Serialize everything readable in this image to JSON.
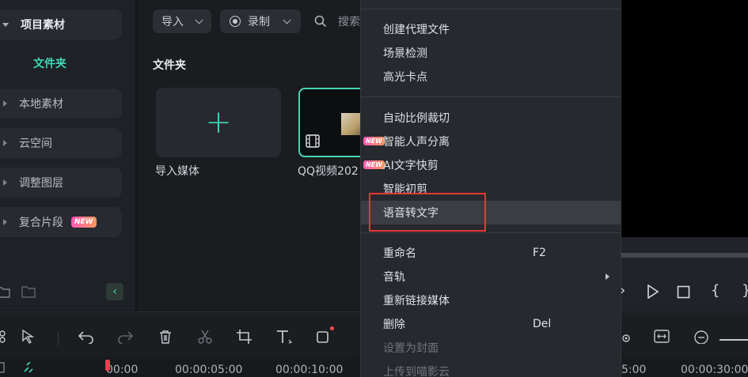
{
  "sidebar": {
    "items": [
      {
        "label": "项目素材"
      },
      {
        "label": "本地素材"
      },
      {
        "label": "云空间"
      },
      {
        "label": "调整图层"
      },
      {
        "label": "复合片段"
      }
    ],
    "folder": "文件夹",
    "new_badge": "NEW"
  },
  "media": {
    "import_label": "导入",
    "record_label": "录制",
    "search_placeholder": "搜索",
    "section_title": "文件夹",
    "cards": [
      {
        "label": "导入媒体"
      },
      {
        "label": "QQ视频202"
      }
    ]
  },
  "context_menu": {
    "items": [
      {
        "label": "创建代理文件"
      },
      {
        "label": "场景检测"
      },
      {
        "label": "高光卡点"
      },
      {
        "label": "自动比例裁切"
      },
      {
        "label": "智能人声分离",
        "badge": "NEW"
      },
      {
        "label": "AI文字快剪",
        "badge": "NEW"
      },
      {
        "label": "智能初剪"
      },
      {
        "label": "语音转文字"
      },
      {
        "label": "重命名",
        "shortcut": "F2"
      },
      {
        "label": "音轨"
      },
      {
        "label": "重新链接媒体"
      },
      {
        "label": "删除",
        "shortcut": "Del"
      },
      {
        "label": "设置为封面"
      },
      {
        "label": "上传到喵影云"
      }
    ]
  },
  "timeline": {
    "ticks": [
      "00:00",
      "00:00:05:00",
      "00:00:10:00",
      "5:00",
      "00:00:30:00"
    ]
  },
  "colors": {
    "accent": "#3fd9b6",
    "highlight_box": "#e53935",
    "new_badge": "#ff57b5"
  }
}
